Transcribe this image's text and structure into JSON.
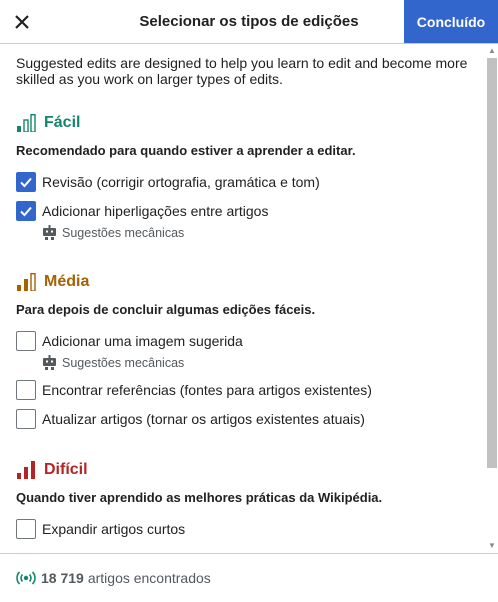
{
  "header": {
    "title": "Selecionar os tipos de edições",
    "done_label": "Concluído"
  },
  "intro": "Suggested edits are designed to help you learn to edit and become more skilled as you work on larger types of edits.",
  "levels": [
    {
      "title": "Fácil",
      "color": "#14866d",
      "description": "Recomendado para quando estiver a aprender a editar.",
      "options": [
        {
          "label": "Revisão (corrigir ortografia, gramática e tom)",
          "checked": true
        },
        {
          "label": "Adicionar hiperligações entre artigos",
          "checked": true,
          "sub": "Sugestões mecânicas"
        }
      ]
    },
    {
      "title": "Média",
      "color": "#a66200",
      "description": "Para depois de concluir algumas edições fáceis.",
      "options": [
        {
          "label": "Adicionar uma imagem sugerida",
          "checked": false,
          "sub": "Sugestões mecânicas"
        },
        {
          "label": "Encontrar referências (fontes para artigos existentes)",
          "checked": false
        },
        {
          "label": "Atualizar artigos (tornar os artigos existentes atuais)",
          "checked": false
        }
      ]
    },
    {
      "title": "Difícil",
      "color": "#b32424",
      "description": "Quando tiver aprendido as melhores práticas da Wikipédia.",
      "options": [
        {
          "label": "Expandir artigos curtos",
          "checked": false
        }
      ]
    }
  ],
  "footer": {
    "count": "18 719",
    "label": "artigos encontrados"
  },
  "icons": {
    "close": "close-icon",
    "check": "check-icon",
    "robot": "robot-icon",
    "level_bars": "difficulty-bars-icon",
    "live": "live-signal-icon"
  }
}
